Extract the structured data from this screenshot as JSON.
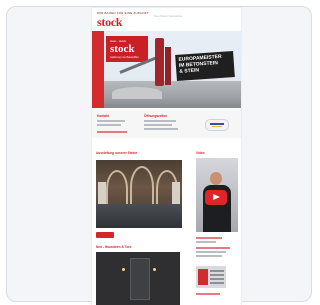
{
  "newsletter": {
    "masthead": {
      "tagline": "WIR BAUEN FÜR EINE ZUKUNFT",
      "logo": "stock",
      "header_note": "Das Stock Newsletter"
    },
    "hero": {
      "logo_small": "stein · stock",
      "logo": "stock",
      "logo_sub": "Lieferung von Baustoffen",
      "banner_lines": [
        "EUROPAMEISTER",
        "IM BETONSTEIN",
        "& STEIN"
      ]
    },
    "contact": {
      "col1_title": "Kontakt",
      "col2_title": "Öffnungszeiten"
    },
    "sections": {
      "gallery_title": "Ausstellung unserer Steine",
      "gallery_button": "Mehr",
      "doors_title": "Neu - Haustüren & Tore",
      "video_title": "Video"
    },
    "colors": {
      "brand_red": "#d6242a",
      "frame": "#f4f5f9",
      "badge_blue": "#2d52a6"
    }
  }
}
